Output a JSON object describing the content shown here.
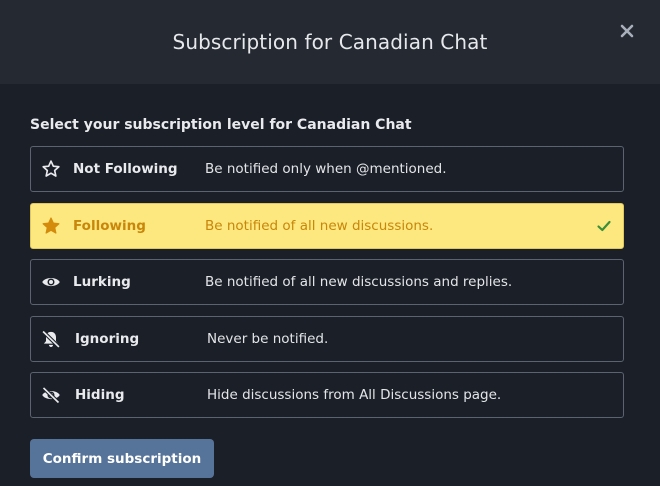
{
  "dialog": {
    "title": "Subscription for Canadian Chat",
    "intro": "Select your subscription level for Canadian Chat"
  },
  "options": [
    {
      "icon": "star-outline-icon",
      "label": "Not Following",
      "description": "Be notified only when @mentioned.",
      "selected": false
    },
    {
      "icon": "star-filled-icon",
      "label": "Following",
      "description": "Be notified of all new discussions.",
      "selected": true
    },
    {
      "icon": "eye-icon",
      "label": "Lurking",
      "description": "Be notified of all new discussions and replies.",
      "selected": false
    },
    {
      "icon": "bell-off-icon",
      "label": "Ignoring",
      "description": "Never be notified.",
      "selected": false
    },
    {
      "icon": "eye-slash-icon",
      "label": "Hiding",
      "description": "Hide discussions from All Discussions page.",
      "selected": false
    }
  ],
  "confirm_label": "Confirm subscription",
  "colors": {
    "background": "#1b1f27",
    "header": "#242932",
    "selected_background": "#fde77f",
    "selected_text": "#c8860a",
    "check": "#3a8f3a",
    "button": "#567399"
  }
}
